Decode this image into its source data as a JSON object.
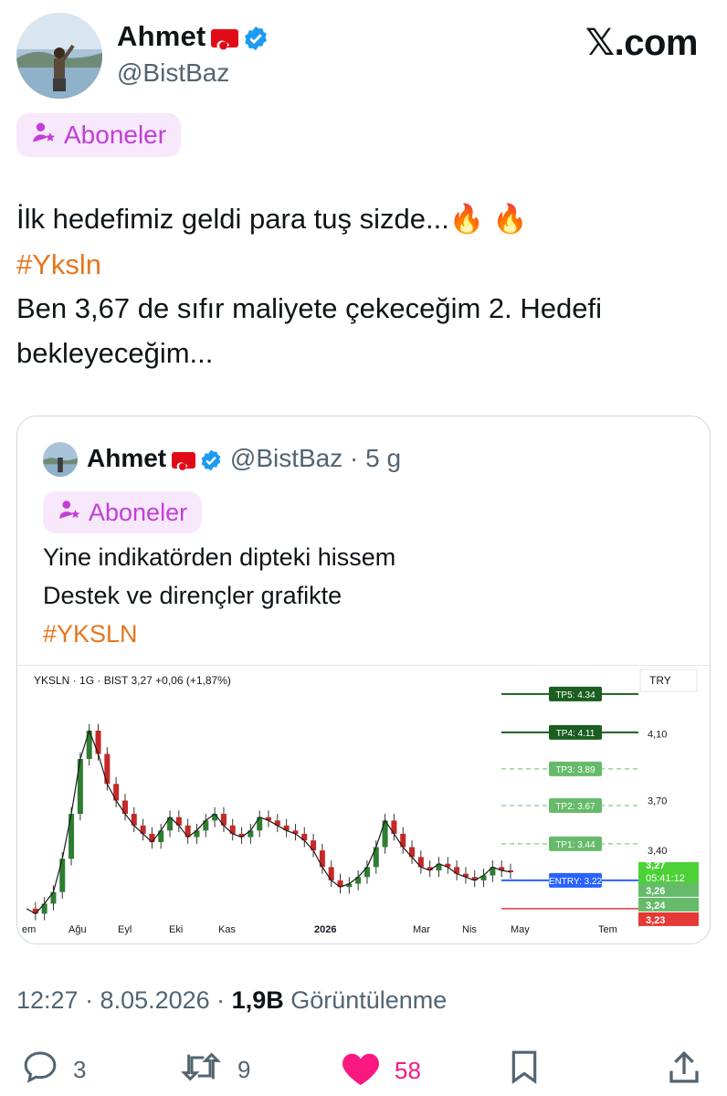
{
  "author": {
    "name": "Ahmet",
    "handle": "@BistBaz"
  },
  "site_logo": "𝕏.com",
  "audience_label": "Aboneler",
  "tweet": {
    "line1": "İlk hedefimiz geldi para tuş sizde...🔥 🔥",
    "hashtag": "#Yksln",
    "line3": "Ben 3,67 de sıfır maliyete çekeceğim 2. Hedefi",
    "line4": "bekleyeceğim..."
  },
  "quote": {
    "name": "Ahmet",
    "handle_time": "@BistBaz · 5 g",
    "audience_label": "Aboneler",
    "line1": "Yine indikatörden dipteki hissem",
    "line2": "Destek ve dirençler grafikte",
    "hashtag": "#YKSLN"
  },
  "chart_data": {
    "type": "line",
    "title": "YKSLN · 1G · BIST  3,27  +0,06 (+1,87%)",
    "currency": "TRY",
    "x_ticks": [
      "em",
      "Ağu",
      "Eyl",
      "Eki",
      "Kas",
      "2026",
      "Mar",
      "Nis",
      "May",
      "Tem"
    ],
    "y_ticks": [
      "4,10",
      "3,70",
      "3,40"
    ],
    "y_range": [
      3.0,
      4.4
    ],
    "levels": [
      {
        "label": "TP5: 4.34",
        "value": 4.34,
        "color": "#1b5e20"
      },
      {
        "label": "TP4: 4.11",
        "value": 4.11,
        "color": "#1b5e20"
      },
      {
        "label": "TP3: 3.89",
        "value": 3.89,
        "color": "#66bb6a"
      },
      {
        "label": "TP2: 3.67",
        "value": 3.67,
        "color": "#66bb6a"
      },
      {
        "label": "TP1: 3.44",
        "value": 3.44,
        "color": "#66bb6a"
      },
      {
        "label": "ENTRY: 3.22",
        "value": 3.22,
        "color": "#2962ff"
      }
    ],
    "price_tags": [
      {
        "text": "3,27",
        "sub": "05:41:12",
        "color": "#4cd137"
      },
      {
        "text": "3,26",
        "color": "#66bb6a"
      },
      {
        "text": "3,24",
        "color": "#66bb6a"
      },
      {
        "text": "3,23",
        "color": "#e53935"
      }
    ],
    "series_close": [
      3.05,
      3.02,
      3.08,
      3.15,
      3.35,
      3.62,
      3.95,
      4.12,
      3.98,
      3.8,
      3.7,
      3.62,
      3.55,
      3.5,
      3.45,
      3.52,
      3.6,
      3.55,
      3.48,
      3.52,
      3.58,
      3.62,
      3.55,
      3.5,
      3.48,
      3.52,
      3.6,
      3.58,
      3.55,
      3.52,
      3.5,
      3.46,
      3.4,
      3.3,
      3.22,
      3.18,
      3.2,
      3.24,
      3.3,
      3.42,
      3.58,
      3.5,
      3.42,
      3.36,
      3.3,
      3.28,
      3.32,
      3.3,
      3.26,
      3.24,
      3.22,
      3.25,
      3.3,
      3.28,
      3.27
    ]
  },
  "footer": {
    "time_date": "12:27 · 8.05.2026 · ",
    "views_count": "1,9B",
    "views_label": " Görüntülenme",
    "replies": "3",
    "retweets": "9",
    "likes": "58"
  },
  "colors": {
    "accent_purple": "#c13fd6",
    "hashtag_orange": "#e8761e",
    "verified_blue": "#1d9bf0",
    "like_pink": "#f91880"
  }
}
